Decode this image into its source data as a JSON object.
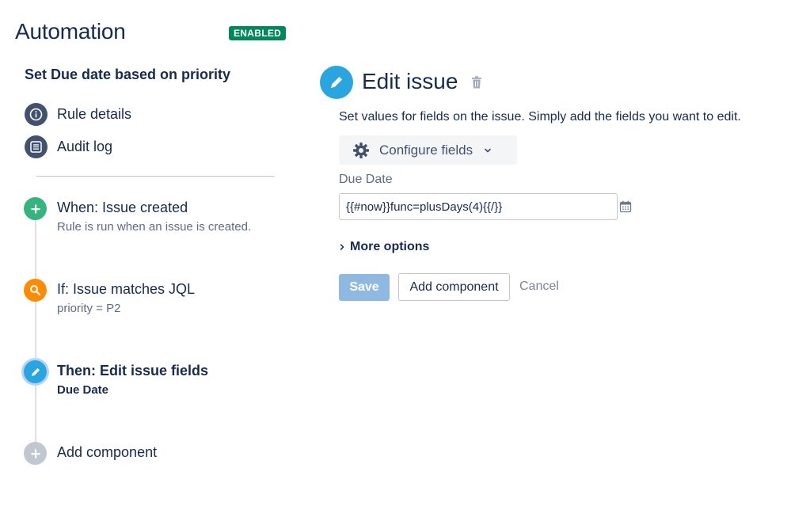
{
  "header": {
    "title": "Automation",
    "status": "ENABLED"
  },
  "sidebar": {
    "rule_name": "Set Due date based on priority",
    "nav": [
      {
        "label": "Rule details",
        "icon": "info-icon"
      },
      {
        "label": "Audit log",
        "icon": "list-icon"
      }
    ],
    "steps": [
      {
        "title": "When: Issue created",
        "subtitle": "Rule is run when an issue is created.",
        "icon": "plus-icon",
        "color": "#36b37e"
      },
      {
        "title": "If: Issue matches JQL",
        "subtitle": "priority = P2",
        "icon": "search-icon",
        "color": "#ff8b00"
      },
      {
        "title": "Then: Edit issue fields",
        "subtitle": "Due Date",
        "icon": "pencil-icon",
        "color": "#2aa5e0",
        "active": true
      },
      {
        "title": "Add component",
        "icon": "plus-icon",
        "color": "#c1c7d0"
      }
    ]
  },
  "editor": {
    "title": "Edit issue",
    "description": "Set values for fields on the issue. Simply add the fields you want to edit.",
    "configure_label": "Configure fields",
    "field_label": "Due Date",
    "field_value": "{{#now}}func=plusDays(4){{/}}",
    "more_options": "More options",
    "save_label": "Save",
    "add_component_label": "Add component",
    "cancel_label": "Cancel"
  },
  "colors": {
    "enabled": "#00875a",
    "accent": "#2aa5e0",
    "save_disabled": "#8fb9e0"
  }
}
